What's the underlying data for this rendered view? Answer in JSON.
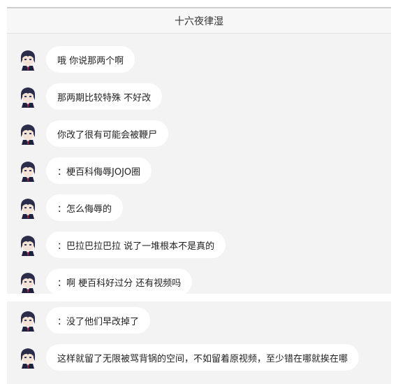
{
  "window": {
    "title": "十六夜律湿"
  },
  "messages": [
    {
      "text": "哦 你说那两个啊"
    },
    {
      "text": "那两期比较特殊 不好改"
    },
    {
      "text": "你改了很有可能会被鞭尸"
    },
    {
      "text": "：梗百科侮辱JOJO圈"
    },
    {
      "text": "：怎么侮辱的"
    },
    {
      "text": "：巴拉巴拉巴拉 说了一堆根本不是真的"
    },
    {
      "text": "：啊 梗百科好过分 还有视频吗"
    },
    {
      "text": "：没了他们早改掉了"
    },
    {
      "text": "这样就留了无限被骂背锅的空间，不如留着原视频，至少错在哪就挨在哪"
    }
  ],
  "colors": {
    "panel_bg": "#f3f3f4",
    "bubble_bg": "#ffffff",
    "text": "#222222",
    "avatar_hair": "#2b2d4a"
  },
  "icons": {
    "avatar": "anime-character-avatar-icon"
  }
}
